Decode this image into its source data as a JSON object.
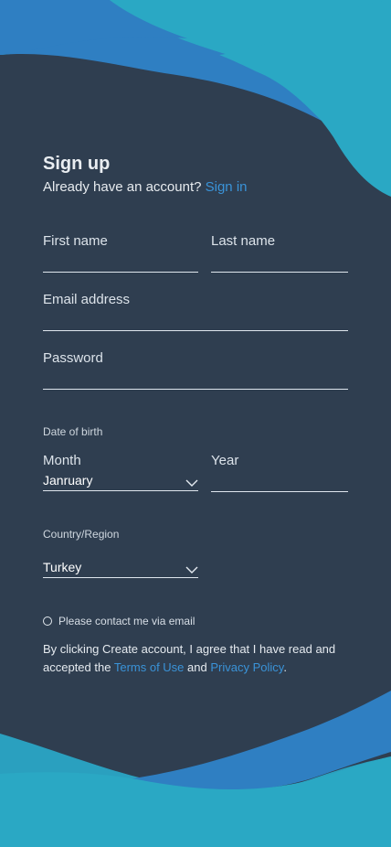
{
  "header": {
    "title": "Sign up",
    "signin_prompt": "Already have an account?",
    "signin_link": "Sign in"
  },
  "form": {
    "first_name_label": "First name",
    "last_name_label": "Last name",
    "email_label": "Email address",
    "password_label": "Password",
    "dob_label": "Date of birth",
    "month_label": "Month",
    "month_value": "Janruary",
    "year_label": "Year",
    "country_label": "Country/Region",
    "country_value": "Turkey",
    "contact_checkbox_label": "Please contact me via email",
    "contact_checkbox_checked": false
  },
  "legal": {
    "text_prefix": "By clicking Create account, I agree that I have read and accepted the",
    "terms_link": "Terms of Use",
    "and_text": "and",
    "privacy_link": "Privacy Policy",
    "period": "."
  },
  "colors": {
    "background": "#2f3e50",
    "accent": "#3a93d8",
    "wave_light": "#2aa8c4",
    "wave_dark": "#2f7fc2"
  },
  "icons": {
    "month_dropdown": "chevron-down-icon",
    "country_dropdown": "chevron-down-icon",
    "checkbox": "radio-circle-icon"
  }
}
